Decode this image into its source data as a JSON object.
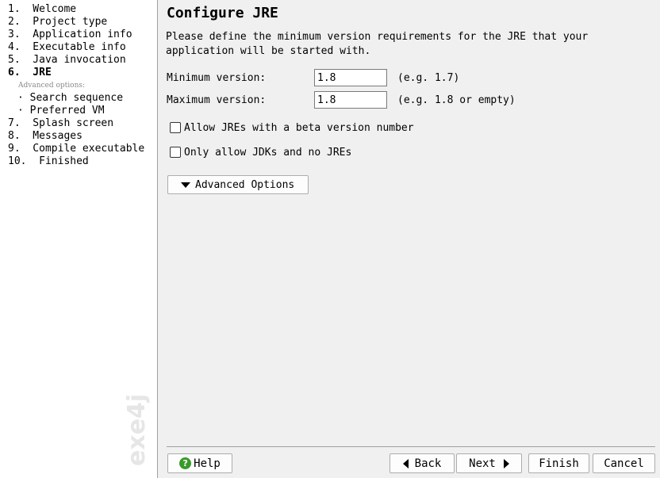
{
  "sidebar": {
    "steps": [
      {
        "label": "1.  Welcome"
      },
      {
        "label": "2.  Project type"
      },
      {
        "label": "3.  Application info"
      },
      {
        "label": "4.  Executable info"
      },
      {
        "label": "5.  Java invocation"
      },
      {
        "label": "6.  JRE"
      },
      {
        "label": "7.  Splash screen"
      },
      {
        "label": "8.  Messages"
      },
      {
        "label": "9.  Compile executable"
      },
      {
        "label": "10.  Finished"
      }
    ],
    "advanced_label": "Advanced options:",
    "sub_steps": [
      {
        "label": "· Search sequence"
      },
      {
        "label": "· Preferred VM"
      }
    ],
    "watermark": "exe4j"
  },
  "main": {
    "title": "Configure JRE",
    "description": "Please define the minimum version requirements for the JRE that your application will be started with.",
    "min_label": "Minimum version:",
    "min_value": "1.8",
    "min_hint": "(e.g. 1.7)",
    "max_label": "Maximum version:",
    "max_value": "1.8",
    "max_hint": "(e.g. 1.8 or empty)",
    "beta_label": "Allow JREs with a beta version number",
    "beta_checked": false,
    "jdk_label": "Only allow JDKs and no JREs",
    "jdk_checked": false,
    "advanced_button": "Advanced Options"
  },
  "footer": {
    "help": "Help",
    "back": "Back",
    "next": "Next",
    "finish": "Finish",
    "cancel": "Cancel"
  },
  "colors": {
    "panel": "#f0f0f0",
    "sidebar": "#ffffff",
    "help_icon": "#3a9a2b"
  }
}
